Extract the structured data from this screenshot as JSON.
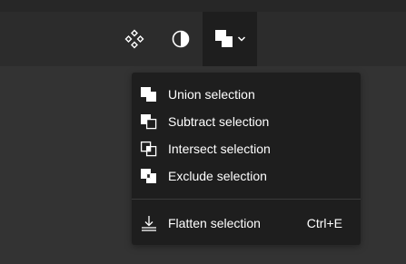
{
  "toolbar": {
    "tools": [
      {
        "icon": "components-icon"
      },
      {
        "icon": "mask-icon"
      },
      {
        "icon": "boolean-groups-icon",
        "active": true
      }
    ]
  },
  "boolean_menu": {
    "items": [
      {
        "label": "Union selection",
        "icon": "union-icon"
      },
      {
        "label": "Subtract selection",
        "icon": "subtract-icon"
      },
      {
        "label": "Intersect selection",
        "icon": "intersect-icon"
      },
      {
        "label": "Exclude selection",
        "icon": "exclude-icon"
      }
    ],
    "flatten": {
      "label": "Flatten selection",
      "shortcut": "Ctrl+E",
      "icon": "flatten-icon"
    }
  },
  "colors": {
    "toolbar_bg": "#2c2c2c",
    "menu_bg": "#1e1e1e",
    "canvas_bg": "#333333",
    "text": "#ffffff"
  }
}
